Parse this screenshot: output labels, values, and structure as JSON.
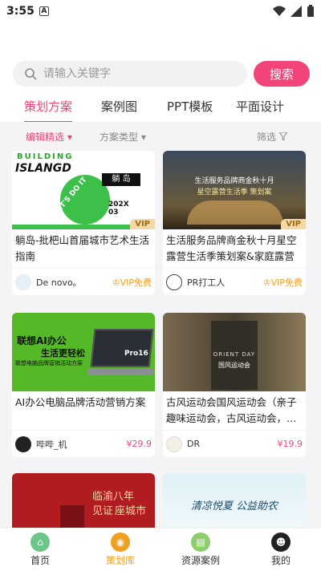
{
  "status": {
    "time": "3:55",
    "sim_icon": "A"
  },
  "search": {
    "placeholder": "请输入关键字",
    "button": "搜索"
  },
  "tabs": [
    {
      "label": "策划方案",
      "active": true
    },
    {
      "label": "案例图",
      "active": false
    },
    {
      "label": "PPT模板",
      "active": false
    },
    {
      "label": "平面设计",
      "active": false
    }
  ],
  "filters": {
    "editor_pick": "编辑精选 ▾",
    "scheme_type": "方案类型 ▾",
    "filter": "筛选"
  },
  "cards": [
    {
      "title": "躺岛-批杷山首届城市艺术生活指南",
      "author": "De novo。",
      "price": "VIP免费",
      "thumb_text": [
        "BUILDING",
        "ISLANGD",
        "躺 岛",
        "202X 03",
        "LET'S DO IT"
      ],
      "vip": "VIP"
    },
    {
      "title": "生活服务品牌商金秋十月星空露营生活季策划案&家庭露营",
      "author": "PR打工人",
      "price": "VIP免费",
      "thumb_text": [
        "生活服务品牌商金秋十月",
        "星空露营生活季 策划案"
      ],
      "vip": "VIP"
    },
    {
      "title": "AI办公电脑品牌活动营销方案",
      "author": "哔哔_机",
      "price": "¥29.9",
      "thumb_text": [
        "联想AI办公",
        "生活更轻松",
        "Pro16",
        "联想电脑品牌营销活动方案"
      ]
    },
    {
      "title": "古风运动会国风运动会（亲子趣味运动会，古风运动会，…",
      "author": "DR",
      "price": "¥19.9",
      "thumb_text": [
        "ORIENT DAY",
        "国风运动会"
      ]
    },
    {
      "title": "",
      "author": "",
      "price": "",
      "thumb_text": [
        "临渝八年",
        "见证",
        "座城市"
      ]
    },
    {
      "title": "",
      "author": "",
      "price": "",
      "thumb_text": [
        "清凉悦夏 公益助农"
      ]
    }
  ],
  "bottom_nav": [
    {
      "label": "首页",
      "icon": "home-icon",
      "active": false
    },
    {
      "label": "策划库",
      "icon": "library-icon",
      "active": true
    },
    {
      "label": "资源案例",
      "icon": "resource-icon",
      "active": false
    },
    {
      "label": "我的",
      "icon": "profile-icon",
      "active": false
    }
  ],
  "colors": {
    "accent": "#f24478",
    "gold": "#f0a020"
  }
}
